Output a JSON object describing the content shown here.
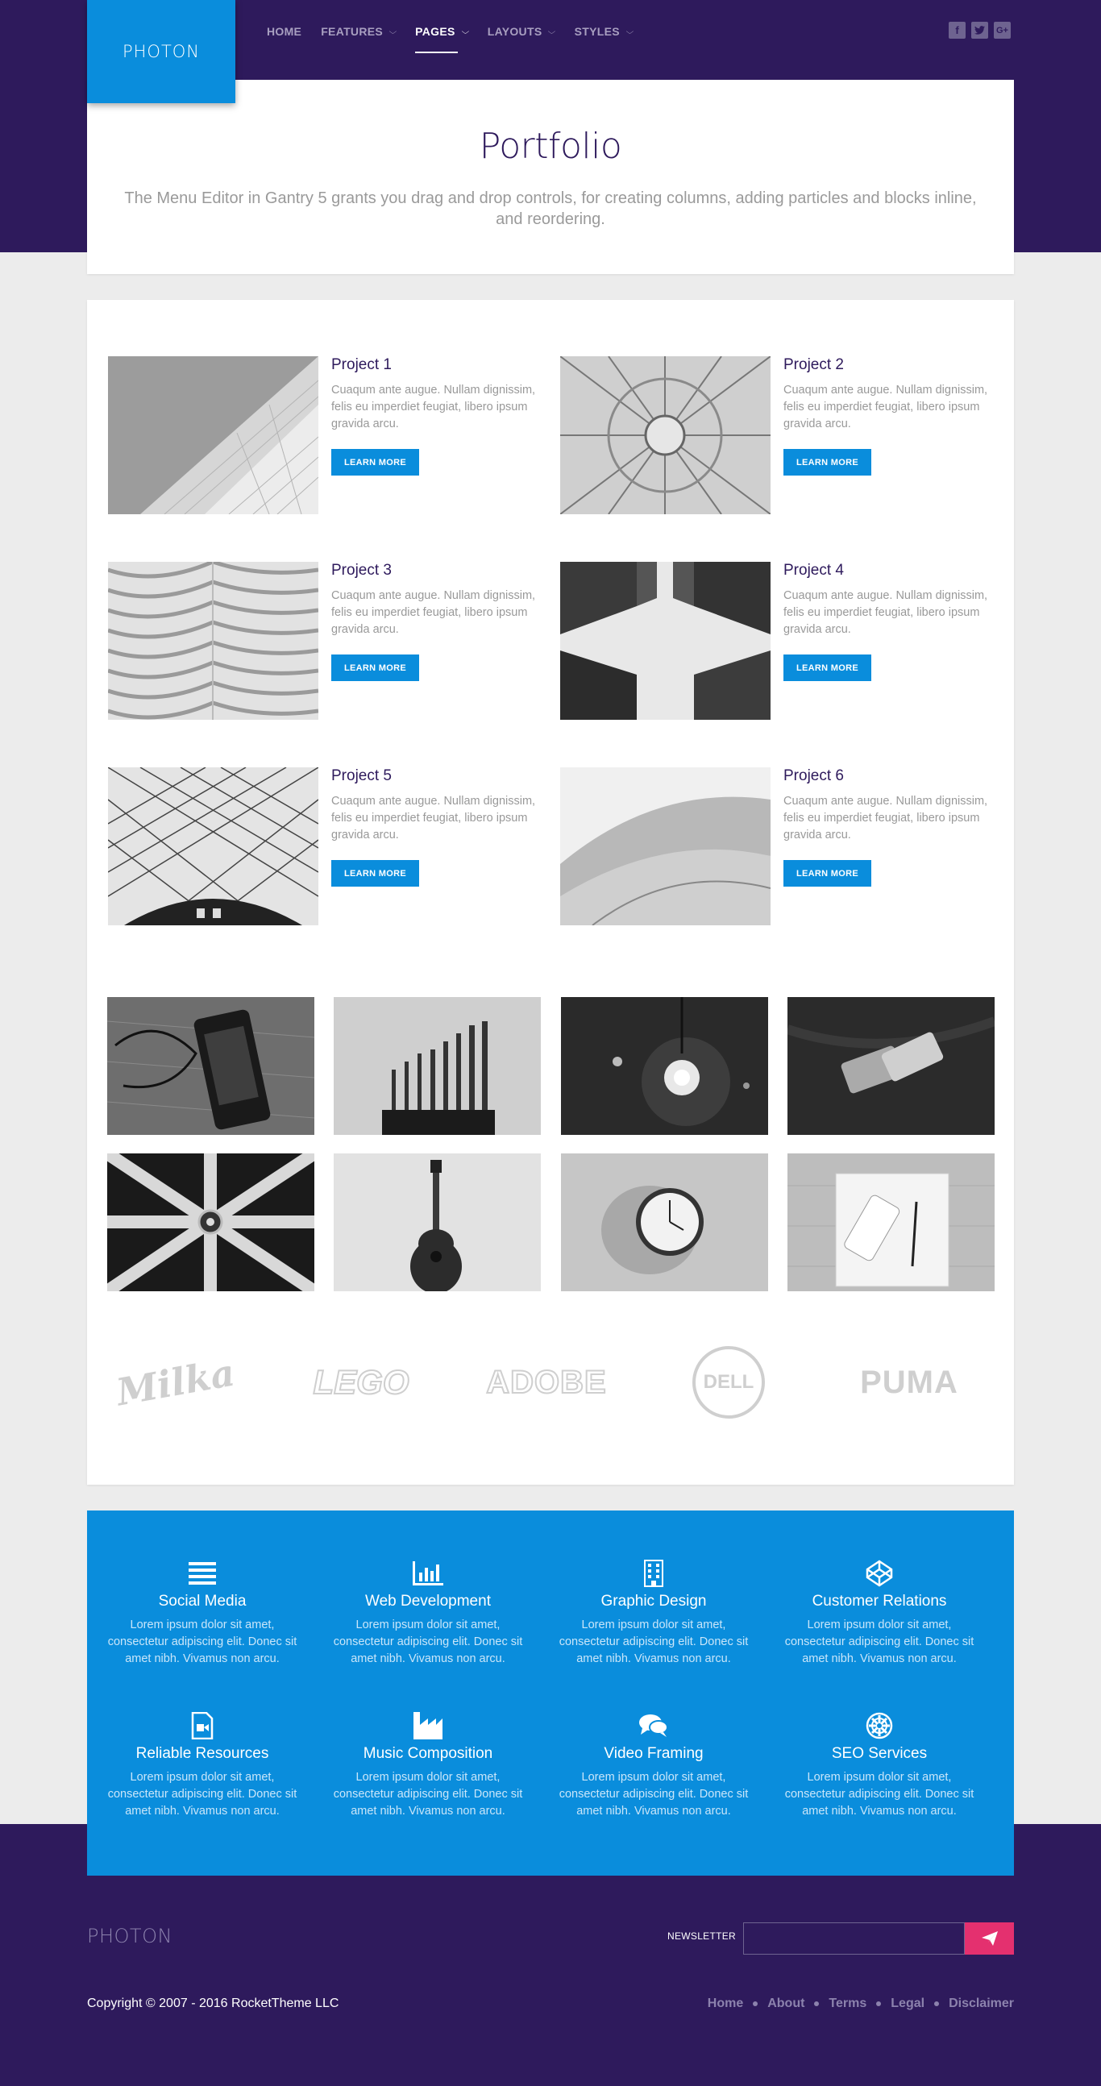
{
  "header": {
    "logo": "PHOTON",
    "nav": [
      {
        "label": "HOME",
        "dropdown": false
      },
      {
        "label": "FEATURES",
        "dropdown": true
      },
      {
        "label": "PAGES",
        "dropdown": true,
        "active": true
      },
      {
        "label": "LAYOUTS",
        "dropdown": true
      },
      {
        "label": "STYLES",
        "dropdown": true
      }
    ],
    "social": [
      "facebook-icon",
      "twitter-icon",
      "google-plus-icon"
    ]
  },
  "hero": {
    "title": "Portfolio",
    "subtitle": "The Menu Editor in Gantry 5 grants you drag and drop controls, for creating columns, adding particles and blocks inline, and reordering."
  },
  "projects": [
    {
      "title": "Project 1",
      "description": "Cuaqum ante augue. Nullam dignissim, felis eu imperdiet feugiat, libero ipsum gravida arcu.",
      "button": "LEARN MORE"
    },
    {
      "title": "Project 2",
      "description": "Cuaqum ante augue. Nullam dignissim, felis eu imperdiet feugiat, libero ipsum gravida arcu.",
      "button": "LEARN MORE"
    },
    {
      "title": "Project 3",
      "description": "Cuaqum ante augue. Nullam dignissim, felis eu imperdiet feugiat, libero ipsum gravida arcu.",
      "button": "LEARN MORE"
    },
    {
      "title": "Project 4",
      "description": "Cuaqum ante augue. Nullam dignissim, felis eu imperdiet feugiat, libero ipsum gravida arcu.",
      "button": "LEARN MORE"
    },
    {
      "title": "Project 5",
      "description": "Cuaqum ante augue. Nullam dignissim, felis eu imperdiet feugiat, libero ipsum gravida arcu.",
      "button": "LEARN MORE"
    },
    {
      "title": "Project 6",
      "description": "Cuaqum ante augue. Nullam dignissim, felis eu imperdiet feugiat, libero ipsum gravida arcu.",
      "button": "LEARN MORE"
    }
  ],
  "gallery": [
    "phone-with-earphones",
    "drill-bits",
    "light-bulb",
    "phones-on-fabric",
    "dartboard",
    "guitar",
    "wall-clock",
    "notebook-with-phone"
  ],
  "brands": [
    "Milka",
    "LEGO",
    "ADOBE",
    "DELL",
    "PUMA"
  ],
  "features": [
    {
      "icon": "list-icon",
      "title": "Social Media",
      "description": "Lorem ipsum dolor sit amet, consectetur adipiscing elit. Donec sit amet nibh. Vivamus non arcu."
    },
    {
      "icon": "bar-chart-icon",
      "title": "Web Development",
      "description": "Lorem ipsum dolor sit amet, consectetur adipiscing elit. Donec sit amet nibh. Vivamus non arcu."
    },
    {
      "icon": "building-icon",
      "title": "Graphic Design",
      "description": "Lorem ipsum dolor sit amet, consectetur adipiscing elit. Donec sit amet nibh. Vivamus non arcu."
    },
    {
      "icon": "codepen-icon",
      "title": "Customer Relations",
      "description": "Lorem ipsum dolor sit amet, consectetur adipiscing elit. Donec sit amet nibh. Vivamus non arcu."
    },
    {
      "icon": "file-video-icon",
      "title": "Reliable Resources",
      "description": "Lorem ipsum dolor sit amet, consectetur adipiscing elit. Donec sit amet nibh. Vivamus non arcu."
    },
    {
      "icon": "industry-icon",
      "title": "Music Composition",
      "description": "Lorem ipsum dolor sit amet, consectetur adipiscing elit. Donec sit amet nibh. Vivamus non arcu."
    },
    {
      "icon": "comments-icon",
      "title": "Video Framing",
      "description": "Lorem ipsum dolor sit amet, consectetur adipiscing elit. Donec sit amet nibh. Vivamus non arcu."
    },
    {
      "icon": "empire-icon",
      "title": "SEO Services",
      "description": "Lorem ipsum dolor sit amet, consectetur adipiscing elit. Donec sit amet nibh. Vivamus non arcu."
    }
  ],
  "footer": {
    "logo": "PHOTON",
    "newsletter_label": "NEWSLETTER",
    "newsletter_placeholder": "",
    "copyright": "Copyright © 2007 - 2016 RocketTheme LLC",
    "links": [
      "Home",
      "About",
      "Terms",
      "Legal",
      "Disclaimer"
    ]
  },
  "colors": {
    "purple": "#2e1a5c",
    "blue": "#0a8ddc",
    "pink": "#e4306f"
  }
}
